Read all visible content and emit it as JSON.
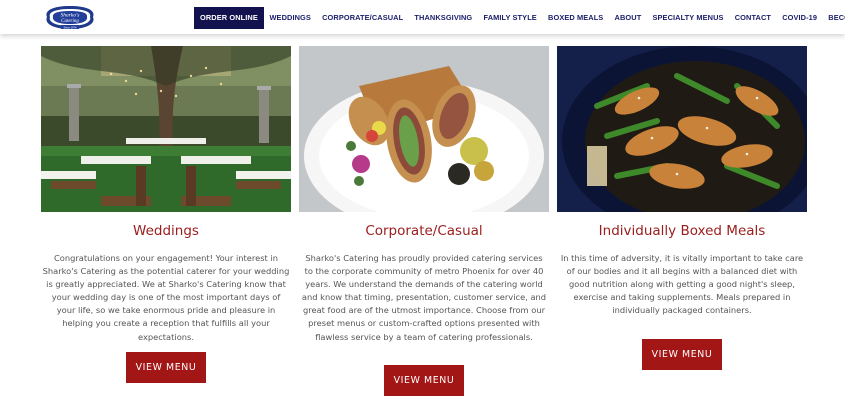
{
  "logo": {
    "alt": "Sharko's Catering",
    "text": "Sharko's Catering",
    "since": "Since 1974"
  },
  "nav": {
    "items": [
      {
        "label": "ORDER ONLINE",
        "active": true
      },
      {
        "label": "WEDDINGS"
      },
      {
        "label": "CORPORATE/CASUAL"
      },
      {
        "label": "THANKSGIVING"
      },
      {
        "label": "FAMILY STYLE"
      },
      {
        "label": "BOXED MEALS"
      },
      {
        "label": "ABOUT"
      },
      {
        "label": "SPECIALTY MENUS"
      },
      {
        "label": "CONTACT"
      },
      {
        "label": "COVID-19"
      },
      {
        "label": "BECOME A VIP"
      }
    ]
  },
  "colors": {
    "nav_text": "#1a1e6b",
    "nav_active_bg": "#12124f",
    "accent": "#a31616",
    "title": "#9b1c1c",
    "body_text": "#555555"
  },
  "columns": [
    {
      "title": "Weddings",
      "image": "wedding-garden-photo",
      "text": "Congratulations on your engagement! Your interest in Sharko's Catering as the potential caterer for your wedding is greatly appreciated. We at Sharko's Catering know that your wedding day is one of the most important days of your life, so we take enormous pride and pleasure in helping you create a reception that fulfills all your expectations.",
      "button": "VIEW MENU"
    },
    {
      "title": "Corporate/Casual",
      "image": "wrap-sandwich-plate-photo",
      "text": "Sharko's Catering has proudly provided catering services to the corporate community of metro Phoenix for over 40 years. We understand the demands of the catering world and know that timing, presentation, customer service, and great food are of the utmost importance. Choose from our preset menus or custom-crafted options presented with flawless service by a team of catering professionals.",
      "button": "VIEW MENU"
    },
    {
      "title": "Individually Boxed Meals",
      "image": "chicken-green-beans-bowl-photo",
      "text": "In this time of adversity, it is vitally important to take care of our bodies and it all begins with a balanced diet with good nutrition along with getting a good night's sleep, exercise and taking supplements. Meals prepared in individually packaged containers.",
      "button": "VIEW MENU"
    }
  ]
}
